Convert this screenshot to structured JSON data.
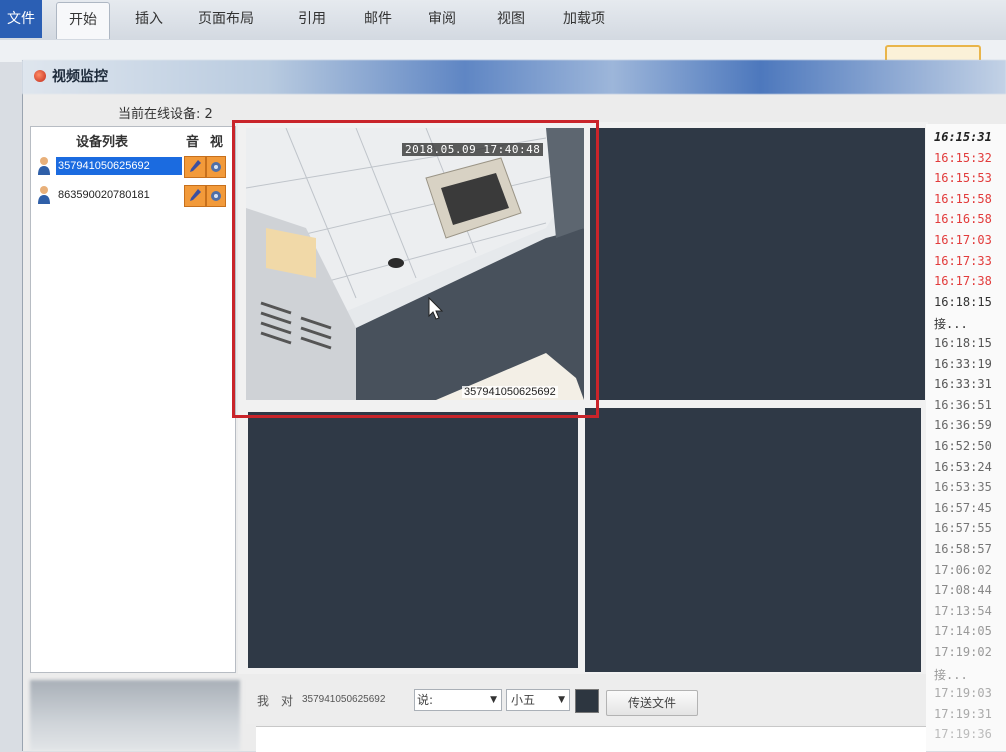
{
  "ribbon": {
    "tabs": [
      "文件",
      "开始",
      "插入",
      "页面布局",
      "引用",
      "邮件",
      "审阅",
      "视图",
      "加载项"
    ],
    "active": "开始"
  },
  "window": {
    "title": "视频监控"
  },
  "online": {
    "label": "当前在线设备: 2"
  },
  "device_list": {
    "headers": {
      "name": "设备列表",
      "audio": "音",
      "video": "视"
    },
    "devices": [
      {
        "id": "357941050625692",
        "selected": true
      },
      {
        "id": "863590020780181",
        "selected": false
      }
    ]
  },
  "video": {
    "panels": [
      {
        "timestamp": "2018.05.09 17:40:48",
        "device_id": "357941050625692",
        "active": true
      },
      {
        "active": false
      },
      {
        "active": false
      },
      {
        "active": false
      }
    ]
  },
  "log": {
    "entries": [
      {
        "time": "16:15:31",
        "color": "#222222",
        "bold": true
      },
      {
        "time": "16:15:32",
        "color": "#e23b3b"
      },
      {
        "time": "16:15:53",
        "color": "#e23b3b"
      },
      {
        "time": "16:15:58",
        "color": "#e23b3b"
      },
      {
        "time": "16:16:58",
        "color": "#e23b3b"
      },
      {
        "time": "16:17:03",
        "color": "#e23b3b"
      },
      {
        "time": "16:17:33",
        "color": "#e23b3b"
      },
      {
        "time": "16:17:38",
        "color": "#e23b3b"
      },
      {
        "time": "16:18:15",
        "color": "#333333"
      },
      {
        "time": "接...",
        "color": "#333333"
      },
      {
        "time": "16:18:15",
        "color": "#555555"
      },
      {
        "time": "16:33:19",
        "color": "#555555"
      },
      {
        "time": "16:33:31",
        "color": "#555555"
      },
      {
        "time": "16:36:51",
        "color": "#666666"
      },
      {
        "time": "16:36:59",
        "color": "#666666"
      },
      {
        "time": "16:52:50",
        "color": "#666666"
      },
      {
        "time": "16:53:24",
        "color": "#666666"
      },
      {
        "time": "16:53:35",
        "color": "#777777"
      },
      {
        "time": "16:57:45",
        "color": "#777777"
      },
      {
        "time": "16:57:55",
        "color": "#777777"
      },
      {
        "time": "16:58:57",
        "color": "#777777"
      },
      {
        "time": "17:06:02",
        "color": "#888888"
      },
      {
        "time": "17:08:44",
        "color": "#888888"
      },
      {
        "time": "17:13:54",
        "color": "#999999"
      },
      {
        "time": "17:14:05",
        "color": "#999999"
      },
      {
        "time": "17:19:02",
        "color": "#999999"
      },
      {
        "time": "接...",
        "color": "#999999"
      },
      {
        "time": "17:19:03",
        "color": "#aaaaaa"
      },
      {
        "time": "17:19:31",
        "color": "#aaaaaa"
      },
      {
        "time": "17:19:36",
        "color": "#bbbbbb"
      }
    ]
  },
  "chat": {
    "me": "我",
    "to": "对",
    "target": "357941050625692",
    "say": "说:",
    "font_size": "小五",
    "send_file": "传送文件"
  },
  "colors": {
    "accent": "#1b6be0",
    "selection_frame": "#c9242a",
    "video_bg": "#2f3946",
    "icon_orange": "#f29a3a"
  }
}
